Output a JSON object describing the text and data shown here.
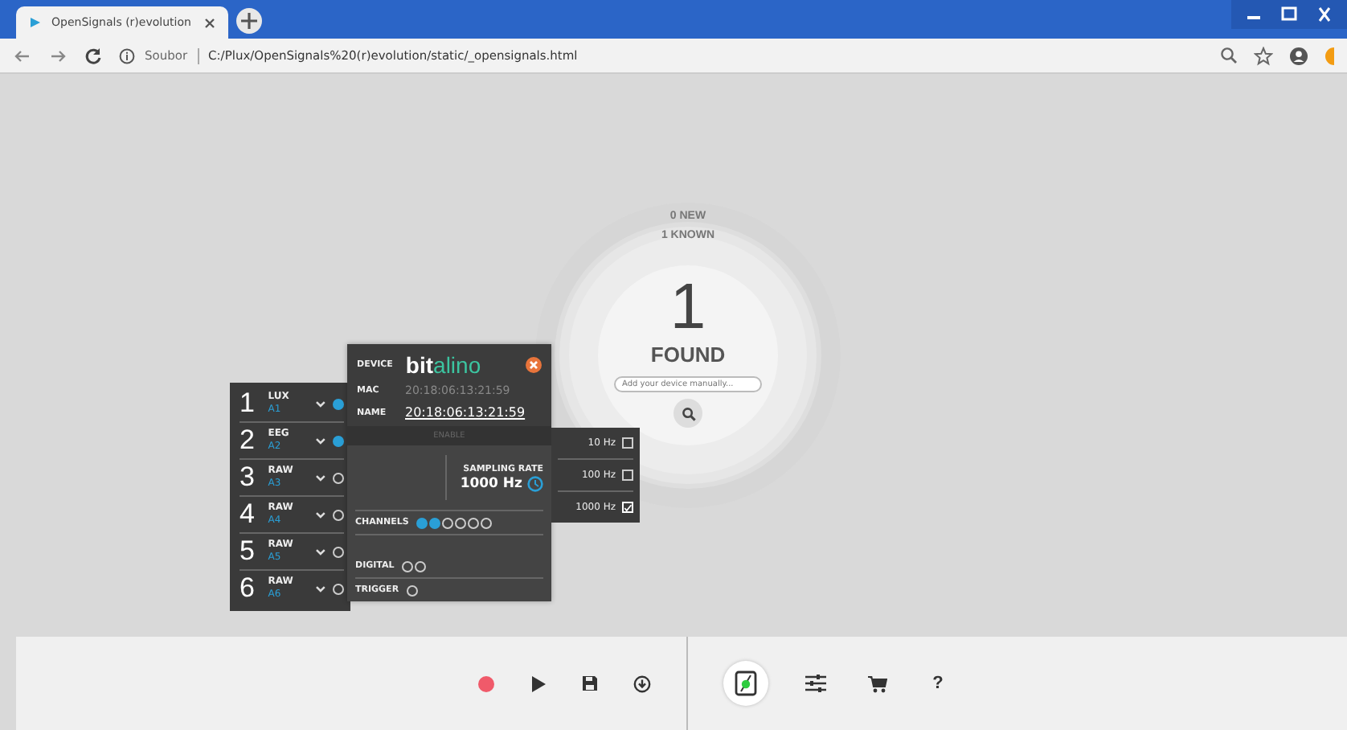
{
  "browser": {
    "tab_title": "OpenSignals (r)evolution",
    "address_prefix": "Soubor",
    "url": "C:/Plux/OpenSignals%20(r)evolution/static/_opensignals.html"
  },
  "scanner": {
    "new": "0 NEW",
    "known": "1 KNOWN",
    "count": "1",
    "found": "FOUND",
    "placeholder": "Add your device manually..."
  },
  "device": {
    "label": "DEVICE",
    "logo_main": "bit",
    "logo_accent": "alino",
    "mac_label": "MAC",
    "mac": "20:18:06:13:21:59",
    "name_label": "NAME",
    "name": "20:18:06:13:21:59",
    "enable": "ENABLE",
    "sampling_label": "SAMPLING RATE",
    "sampling": "1000 Hz",
    "channels_label": "CHANNELS",
    "digital_label": "DIGITAL",
    "digital": [
      false,
      false
    ],
    "trigger_label": "TRIGGER",
    "trigger": [
      false
    ]
  },
  "channels": [
    {
      "number": "1",
      "type": "LUX",
      "port": "A1",
      "active": true
    },
    {
      "number": "2",
      "type": "EEG",
      "port": "A2",
      "active": true
    },
    {
      "number": "3",
      "type": "RAW",
      "port": "A3",
      "active": false
    },
    {
      "number": "4",
      "type": "RAW",
      "port": "A4",
      "active": false
    },
    {
      "number": "5",
      "type": "RAW",
      "port": "A5",
      "active": false
    },
    {
      "number": "6",
      "type": "RAW",
      "port": "A6",
      "active": false
    }
  ],
  "rates": [
    {
      "label": "10 Hz",
      "selected": false
    },
    {
      "label": "100 Hz",
      "selected": false
    },
    {
      "label": "1000 Hz",
      "selected": true
    }
  ],
  "toolbar": {
    "left": [
      {
        "kind": "record"
      },
      {
        "kind": "play"
      },
      {
        "kind": "save"
      },
      {
        "kind": "download"
      }
    ],
    "right": [
      {
        "kind": "devices",
        "selected": true
      },
      {
        "kind": "settings",
        "selected": false
      },
      {
        "kind": "cart",
        "selected": false
      },
      {
        "kind": "help",
        "label": "?",
        "selected": false
      }
    ]
  }
}
